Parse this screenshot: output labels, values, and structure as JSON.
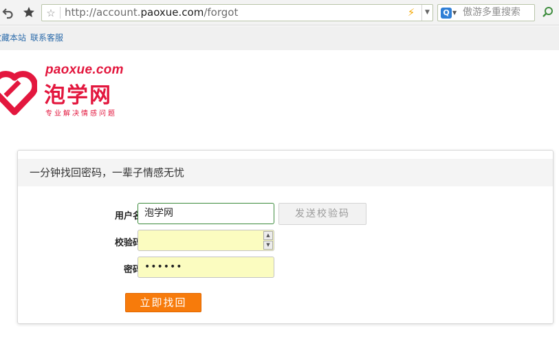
{
  "browser": {
    "back_icon": "undo-arrow-icon",
    "favorite_icon": "star-icon",
    "bookmark_icon": "outline-star-icon",
    "url_prefix": "http://account.",
    "url_domain": "paoxue.com",
    "url_path": "/forgot",
    "search_engine_icon": "Q",
    "search_placeholder": "傲游多重搜索",
    "lightning_icon": "⚡",
    "dropdown_icon": "▼",
    "engine_dropdown_icon": "▼",
    "right_icon": "⤴"
  },
  "sitebar": {
    "bookmark_label": "收藏本站",
    "support_label": "联系客服"
  },
  "logo": {
    "en": "paoxue.com",
    "cn": "泡学网",
    "slogan": "专业解决情感问题",
    "brand_color": "#e3173e"
  },
  "panel": {
    "title": "一分钟找回密码，一辈子情感无忧"
  },
  "form": {
    "username_label": "用户名",
    "username_value": "泡学网",
    "send_code_label": "发送校验码",
    "code_label": "校验码",
    "code_value": "",
    "password_label": "密码",
    "password_value": "••••••",
    "submit_label": "立即找回",
    "accent_color": "#f77b0b"
  }
}
